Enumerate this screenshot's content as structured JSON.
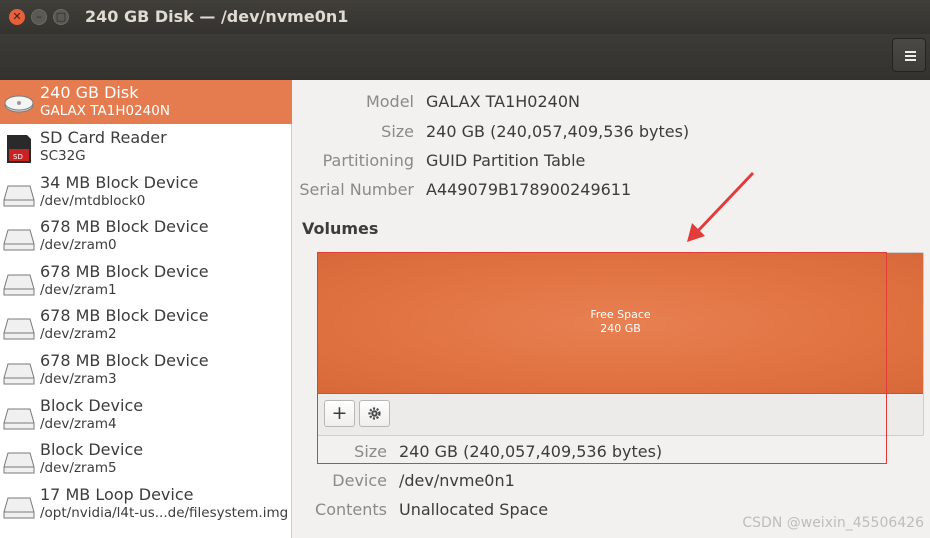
{
  "window": {
    "title": "240 GB Disk — /dev/nvme0n1"
  },
  "devices": [
    {
      "name": "240 GB Disk",
      "sub": "GALAX TA1H0240N",
      "icon": "hard-disk-icon",
      "selected": true
    },
    {
      "name": "SD Card Reader",
      "sub": "SC32G",
      "icon": "sd-card-icon",
      "selected": false
    },
    {
      "name": "34 MB Block Device",
      "sub": "/dev/mtdblock0",
      "icon": "drive-icon",
      "selected": false
    },
    {
      "name": "678 MB Block Device",
      "sub": "/dev/zram0",
      "icon": "drive-icon",
      "selected": false
    },
    {
      "name": "678 MB Block Device",
      "sub": "/dev/zram1",
      "icon": "drive-icon",
      "selected": false
    },
    {
      "name": "678 MB Block Device",
      "sub": "/dev/zram2",
      "icon": "drive-icon",
      "selected": false
    },
    {
      "name": "678 MB Block Device",
      "sub": "/dev/zram3",
      "icon": "drive-icon",
      "selected": false
    },
    {
      "name": "Block Device",
      "sub": "/dev/zram4",
      "icon": "drive-icon",
      "selected": false
    },
    {
      "name": "Block Device",
      "sub": "/dev/zram5",
      "icon": "drive-icon",
      "selected": false
    },
    {
      "name": "17 MB Loop Device",
      "sub": "/opt/nvidia/l4t-us...de/filesystem.img",
      "icon": "drive-icon",
      "selected": false
    }
  ],
  "disk_info": {
    "model_label": "Model",
    "model": "GALAX TA1H0240N",
    "size_label": "Size",
    "size": "240 GB (240,057,409,536 bytes)",
    "partitioning_label": "Partitioning",
    "partitioning": "GUID Partition Table",
    "serial_label": "Serial Number",
    "serial": "A449079B178900249611"
  },
  "volumes": {
    "title": "Volumes",
    "segment_name": "Free Space",
    "segment_size": "240 GB",
    "add_label": "+",
    "settings_icon": "gear-icon"
  },
  "volume_info": {
    "size_label": "Size",
    "size": "240 GB (240,057,409,536 bytes)",
    "device_label": "Device",
    "device": "/dev/nvme0n1",
    "contents_label": "Contents",
    "contents": "Unallocated Space"
  },
  "watermark": "CSDN @weixin_45506426",
  "colors": {
    "accent": "#e57c50",
    "annotation": "#e23b3b",
    "titlebar": "#3a3935"
  }
}
